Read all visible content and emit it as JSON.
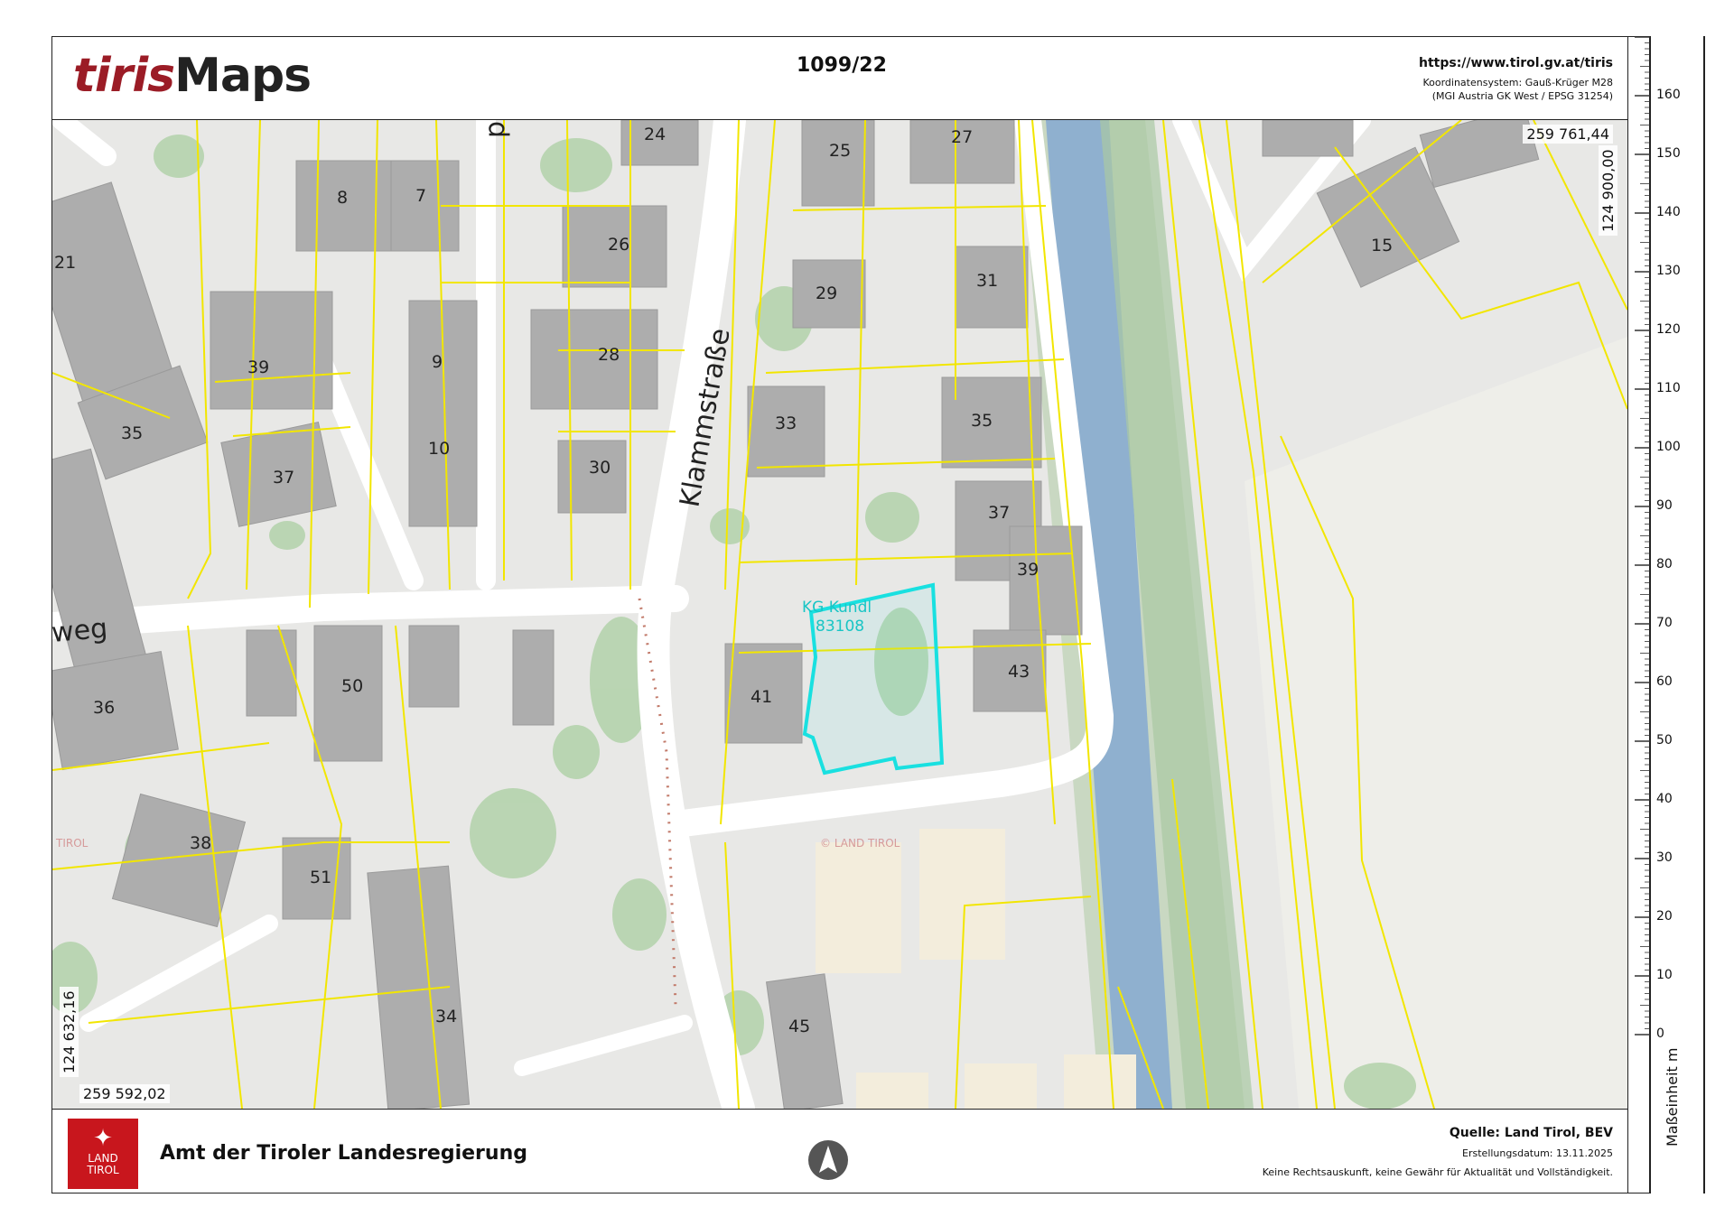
{
  "header": {
    "logo_part1": "tiris",
    "logo_part2": "Maps",
    "title": "1099/22",
    "url": "https://www.tirol.gv.at/tiris",
    "crs_line1": "Koordinatensystem: Gauß-Krüger M28",
    "crs_line2": "(MGI Austria GK West / EPSG 31254)"
  },
  "map": {
    "coord_top_right": "259 761,44",
    "coord_right_vertical": "124 900,00",
    "coord_left_vertical": "124 632,16",
    "coord_bottom_left": "259 592,02",
    "streets": [
      "Klammstraße",
      "weg",
      "p"
    ],
    "parcel_label_line1": "KG Kundl",
    "parcel_label_line2": "83108",
    "watermark_main": "© LAND TIROL",
    "watermark_left": "TIROL",
    "house_numbers": [
      "24",
      "25",
      "27",
      "8",
      "7",
      "26",
      "21",
      "29",
      "31",
      "39",
      "9",
      "28",
      "35",
      "33",
      "35",
      "10",
      "30",
      "37",
      "37",
      "39",
      "41",
      "43",
      "36",
      "50",
      "38",
      "51",
      "34",
      "45",
      "15"
    ],
    "colors": {
      "parcel_highlight": "#19e0e0",
      "parcel_lines": "#f2e600",
      "river": "#8fb0cf",
      "buildings": "#aeaeae"
    }
  },
  "footer": {
    "logo_line1": "LAND",
    "logo_line2": "TIROL",
    "agency": "Amt der Tiroler Landesregierung",
    "source": "Quelle: Land Tirol, BEV",
    "created": "Erstellungsdatum:   13.11.2025",
    "disclaimer": "Keine Rechtsauskunft, keine Gewähr für Aktualität und Vollständigkeit.",
    "north_icon": "north-arrow-icon"
  },
  "scale": {
    "unit_label": "Maßeinheit m",
    "labels": [
      "160",
      "150",
      "140",
      "130",
      "120",
      "110",
      "100",
      "90",
      "80",
      "70",
      "60",
      "50",
      "40",
      "30",
      "20",
      "10",
      "0"
    ]
  }
}
